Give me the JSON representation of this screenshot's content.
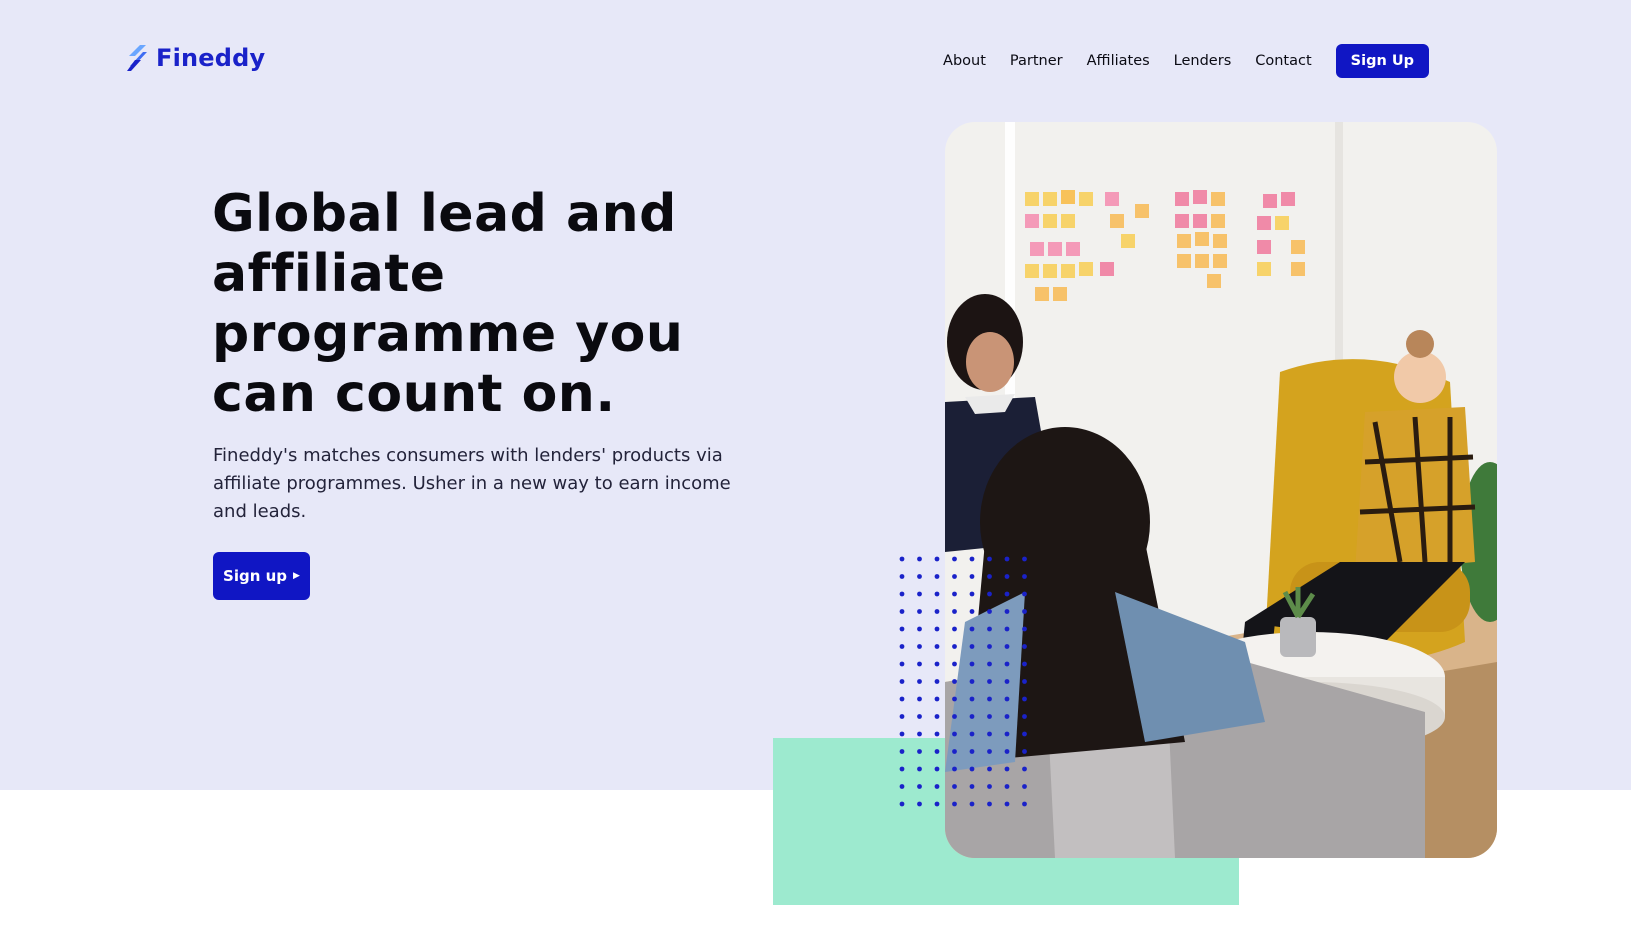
{
  "brand": {
    "name": "Fineddy",
    "color": "#1a22c9"
  },
  "nav": {
    "items": [
      "About",
      "Partner",
      "Affiliates",
      "Lenders",
      "Contact"
    ],
    "signup_label": "Sign Up"
  },
  "hero": {
    "headline_lines": [
      "Global lead and",
      "affiliate",
      "programme you",
      "can count on."
    ],
    "subtext_lines": [
      "Fineddy's matches consumers with lenders' products via",
      "affiliate programmes. Usher in a new way to earn income",
      "and leads."
    ],
    "cta_label": "Sign up",
    "cta_icon": "caret-right-icon"
  },
  "colors": {
    "hero_background": "#e7e8f8",
    "primary_button": "#1016c4",
    "accent_mint": "#9deacf",
    "dot_pattern": "#1a22c9"
  },
  "photo": {
    "subject": "three women in a meeting room with sticky notes"
  }
}
